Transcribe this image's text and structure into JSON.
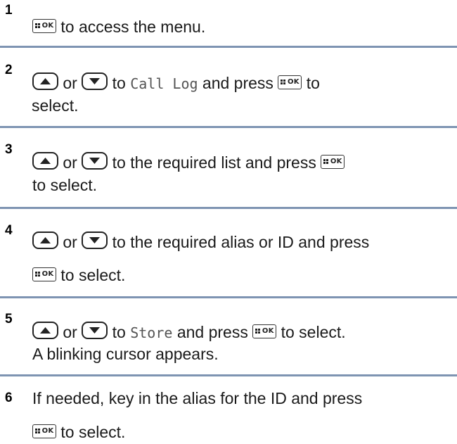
{
  "icons": {
    "ok_key": "ok-key-icon",
    "up_key": "up-arrow-key-icon",
    "down_key": "down-arrow-key-icon"
  },
  "colors": {
    "divider": "#7e94b2"
  },
  "common": {
    "or": "or",
    "to": "to",
    "and_press": "and press",
    "ok_label": "OK"
  },
  "steps": [
    {
      "number": "1",
      "line1_after_ok": "to access the menu."
    },
    {
      "number": "2",
      "line1_middle": "to",
      "menu_item": "Call Log",
      "line2": "select."
    },
    {
      "number": "3",
      "line1_middle": "to the required list and press",
      "line2": "to select."
    },
    {
      "number": "4",
      "line1_middle": "to the required alias or ID and press",
      "line2_after_ok": "to select."
    },
    {
      "number": "5",
      "line1_middle": "to",
      "menu_item": "Store",
      "line1_end": "to select.",
      "line2": "A blinking cursor appears."
    },
    {
      "number": "6",
      "line1": "If needed, key in the alias for the ID and press",
      "line2_after_ok": "to select."
    }
  ]
}
